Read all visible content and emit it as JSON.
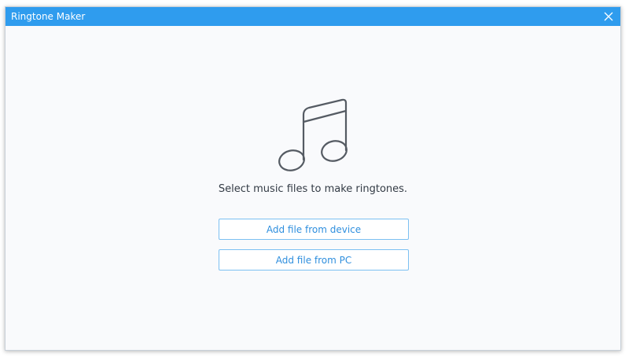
{
  "window": {
    "title": "Ringtone Maker"
  },
  "icons": {
    "close": "close-icon",
    "main": "music-note-icon"
  },
  "main": {
    "prompt": "Select music files to make ringtones.",
    "add_from_device_label": "Add file from device",
    "add_from_pc_label": "Add file from PC"
  },
  "colors": {
    "titlebar": "#2f9cee",
    "accent": "#2f8fde",
    "button_border": "#7cc0f2"
  }
}
